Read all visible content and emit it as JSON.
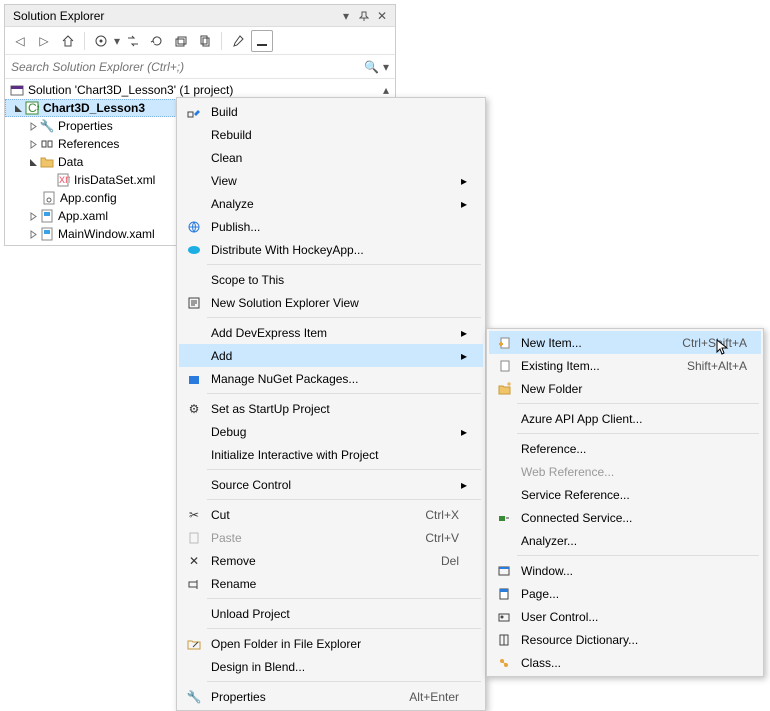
{
  "panel": {
    "title": "Solution Explorer",
    "search_placeholder": "Search Solution Explorer (Ctrl+;)"
  },
  "tree": {
    "solution": "Solution 'Chart3D_Lesson3' (1 project)",
    "project": "Chart3D_Lesson3",
    "properties": "Properties",
    "references": "References",
    "data_folder": "Data",
    "iris": "IrisDataSet.xml",
    "appconfig": "App.config",
    "appxaml": "App.xaml",
    "mainwindow": "MainWindow.xaml"
  },
  "menu": {
    "build": "Build",
    "rebuild": "Rebuild",
    "clean": "Clean",
    "view": "View",
    "analyze": "Analyze",
    "publish": "Publish...",
    "distribute": "Distribute With HockeyApp...",
    "scope": "Scope to This",
    "newview": "New Solution Explorer View",
    "adddx": "Add DevExpress Item",
    "add": "Add",
    "nuget": "Manage NuGet Packages...",
    "startup": "Set as StartUp Project",
    "debug": "Debug",
    "initinter": "Initialize Interactive with Project",
    "sourcectrl": "Source Control",
    "cut": "Cut",
    "cut_s": "Ctrl+X",
    "paste": "Paste",
    "paste_s": "Ctrl+V",
    "remove": "Remove",
    "remove_s": "Del",
    "rename": "Rename",
    "unload": "Unload Project",
    "openfolder": "Open Folder in File Explorer",
    "blend": "Design in Blend...",
    "properties": "Properties",
    "properties_s": "Alt+Enter"
  },
  "submenu": {
    "newitem": "New Item...",
    "newitem_s": "Ctrl+Shift+A",
    "existitem": "Existing Item...",
    "existitem_s": "Shift+Alt+A",
    "newfolder": "New Folder",
    "azure": "Azure API App Client...",
    "reference": "Reference...",
    "webref": "Web Reference...",
    "svcref": "Service Reference...",
    "connsvc": "Connected Service...",
    "analyzer": "Analyzer...",
    "window": "Window...",
    "page": "Page...",
    "userctrl": "User Control...",
    "resdict": "Resource Dictionary...",
    "class": "Class..."
  }
}
